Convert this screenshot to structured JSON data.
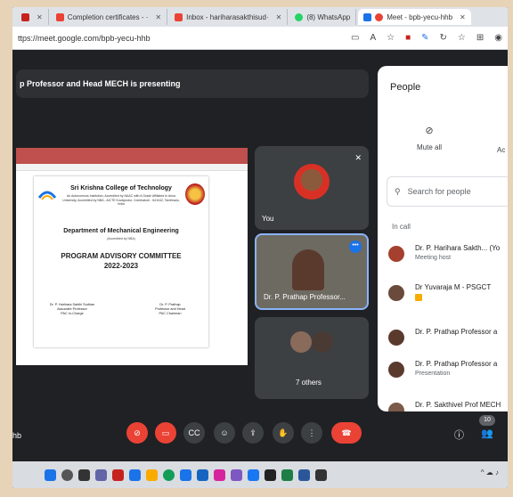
{
  "browser": {
    "tabs": [
      {
        "label": "",
        "color": "#c5221f"
      },
      {
        "label": "Completion certificates - ·",
        "color": "#ea4335"
      },
      {
        "label": "Inbox - hariharasakthisud·",
        "color": "#ea4335"
      },
      {
        "label": "(8) WhatsApp",
        "color": "#25d366"
      },
      {
        "label": "Meet - bpb-yecu-hhb",
        "color": "#1a73e8",
        "active": true
      }
    ],
    "url": "ttps://meet.google.com/bpb-yecu-hhb"
  },
  "meet": {
    "presenting_banner": "p Professor and Head MECH is presenting",
    "meeting_code_fragment": "hb",
    "tiles": {
      "you_label": "You",
      "presenter_label": "Dr. P. Prathap Professor...",
      "others_label": "7 others"
    },
    "participant_count": "10",
    "controls": [
      "mic-off",
      "camera-off",
      "captions",
      "emoji",
      "present",
      "raise-hand",
      "more",
      "end-call"
    ]
  },
  "slide": {
    "college": "Sri Krishna College of Technology",
    "college_sub": "An Autonomous Institution, Accredited by NAAC with A Grade Affiliated to Anna University, Accredited by NBA - AICTE Kovaipudur, Coimbatore - 641042, Tamilnadu, India",
    "department": "Department of Mechanical Engineering",
    "accreditation": "(Accredited by NBA)",
    "title_line1": "PROGRAM ADVISORY COMMITTEE",
    "title_line2": "2022-2023",
    "sign_left": [
      "Dr. P. Harihara Sakthi Sudhan",
      "Associate Professor",
      "PAC In-Charge"
    ],
    "sign_right": [
      "Dr. P. Prathap",
      "Professor and Head",
      "PAC Chairman"
    ]
  },
  "people_panel": {
    "title": "People",
    "mute_all": "Mute all",
    "add_fragment": "Ac",
    "search_placeholder": "Search for people",
    "in_call_label": "In call",
    "participants": [
      {
        "name": "Dr. P. Harihara Sakth... (Yo",
        "sub": "Meeting host"
      },
      {
        "name": "Dr Yuvaraja M - PSGCT",
        "sub": ""
      },
      {
        "name": "Dr. P. Prathap Professor a",
        "sub": ""
      },
      {
        "name": "Dr. P. Prathap Professor a",
        "sub": "Presentation"
      },
      {
        "name": "Dr. P. Sakthivel Prof MECH",
        "sub": ""
      }
    ]
  }
}
